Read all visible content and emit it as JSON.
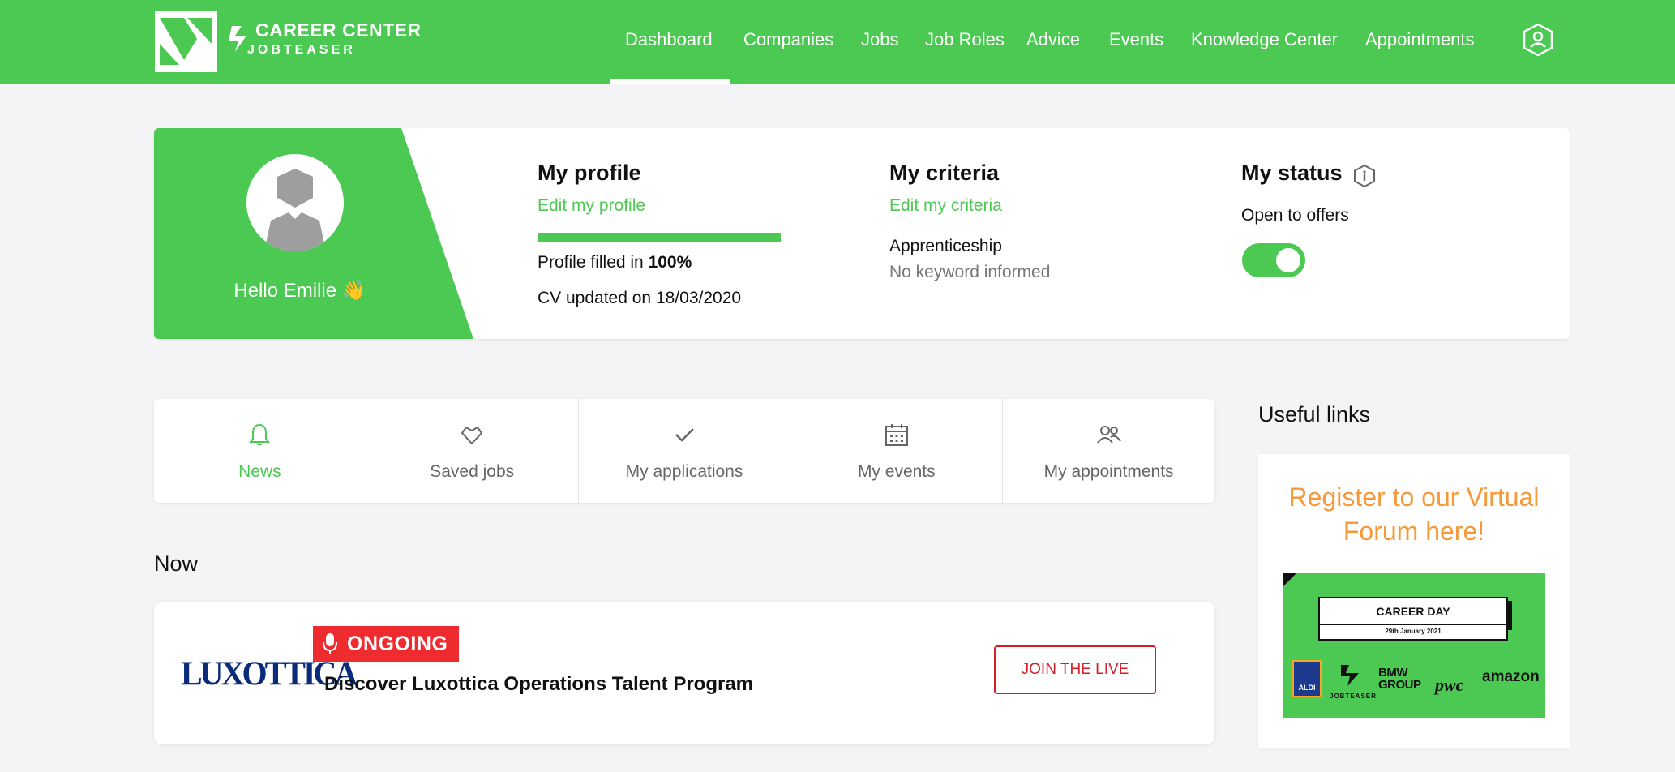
{
  "header": {
    "logo_line1": "CAREER CENTER",
    "logo_line2": "JOBTEASER",
    "nav": [
      "Dashboard",
      "Companies",
      "Jobs",
      "Job Roles",
      "Advice",
      "Events",
      "Knowledge Center",
      "Appointments"
    ],
    "active_nav": "Dashboard"
  },
  "profile_card": {
    "greeting": "Hello Emilie",
    "greeting_emoji": "👋",
    "profile": {
      "title": "My profile",
      "edit_link": "Edit my profile",
      "progress_percent": 100,
      "filled_prefix": "Profile filled in ",
      "filled_value": "100%",
      "cv_updated": "CV updated on 18/03/2020"
    },
    "criteria": {
      "title": "My criteria",
      "edit_link": "Edit my criteria",
      "type": "Apprenticeship",
      "keywords": "No keyword informed"
    },
    "status": {
      "title": "My status",
      "label": "Open to offers",
      "toggle_on": true
    }
  },
  "tabs": [
    {
      "label": "News",
      "icon": "bell-icon",
      "active": true
    },
    {
      "label": "Saved jobs",
      "icon": "heart-icon",
      "active": false
    },
    {
      "label": "My applications",
      "icon": "check-icon",
      "active": false
    },
    {
      "label": "My events",
      "icon": "calendar-icon",
      "active": false
    },
    {
      "label": "My appointments",
      "icon": "people-icon",
      "active": false
    }
  ],
  "now": {
    "heading": "Now",
    "event": {
      "company": "LUXOTTICA",
      "badge": "ONGOING",
      "title": "Discover Luxottica Operations Talent Program",
      "button": "JOIN THE LIVE"
    }
  },
  "useful_links": {
    "heading": "Useful links",
    "promo_title": "Register to our Virtual Forum here!",
    "banner": {
      "title": "CAREER DAY",
      "date": "29th January 2021",
      "sponsors": [
        "ALDI",
        "JOBTEASER",
        "BMW GROUP",
        "pwc",
        "amazon"
      ]
    }
  },
  "colors": {
    "brand_green": "#4cc952",
    "live_red": "#ee2b2f",
    "promo_orange": "#f5993a"
  }
}
